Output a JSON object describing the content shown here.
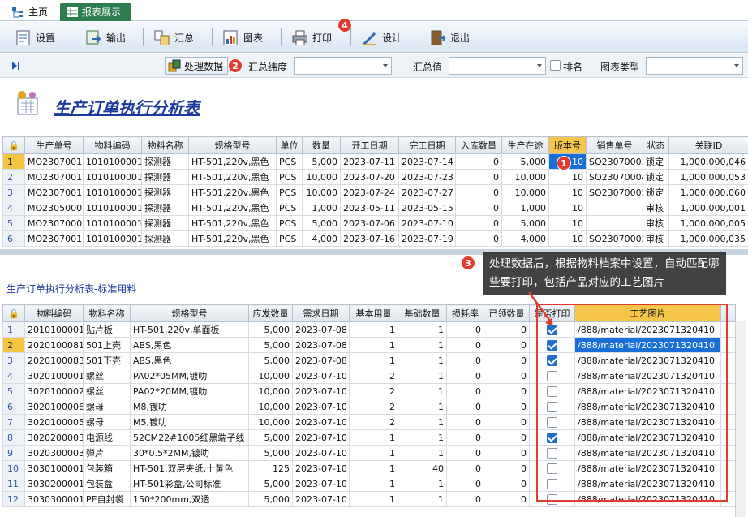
{
  "tabs": [
    {
      "label": "主页"
    },
    {
      "label": "报表展示"
    }
  ],
  "toolbar": {
    "settings": "设置",
    "export": "输出",
    "summary": "汇总",
    "chart": "图表",
    "print": "打印",
    "design": "设计",
    "exit": "退出",
    "badge4": "4"
  },
  "filter": {
    "process_label": "处理数据",
    "badge2": "2",
    "dim_label": "汇总纬度",
    "value_label": "汇总值",
    "rank_label": "排名",
    "charttype_label": "图表类型"
  },
  "report_title": "生产订单执行分析表",
  "grid1": {
    "headers": [
      "生产单号",
      "物料编码",
      "物料名称",
      "规格型号",
      "单位",
      "数量",
      "开工日期",
      "完工日期",
      "入库数量",
      "生产在途",
      "版本号",
      "销售单号",
      "状态",
      "关联ID"
    ],
    "rows": [
      [
        "1",
        "MO23070012",
        "1010100001",
        "探测器",
        "HT-501,220v,黑色",
        "PCS",
        "5,000",
        "2023-07-11",
        "2023-07-14",
        "0",
        "5,000",
        "10",
        "SO23070003",
        "锁定",
        "1,000,000,046"
      ],
      [
        "2",
        "MO23070015",
        "1010100001",
        "探测器",
        "HT-501,220v,黑色",
        "PCS",
        "10,000",
        "2023-07-20",
        "2023-07-23",
        "0",
        "10,000",
        "10",
        "SO23070004",
        "锁定",
        "1,000,000,053"
      ],
      [
        "3",
        "MO23070016",
        "1010100001",
        "探测器",
        "HT-501,220v,黑色",
        "PCS",
        "10,000",
        "2023-07-24",
        "2023-07-27",
        "0",
        "10,000",
        "10",
        "SO23070005",
        "锁定",
        "1,000,000,060"
      ],
      [
        "4",
        "MO23050001",
        "1010100001",
        "探测器",
        "HT-501,220v,黑色",
        "PCS",
        "1,000",
        "2023-05-11",
        "2023-05-15",
        "0",
        "1,000",
        "10",
        "",
        "审核",
        "1,000,000,001"
      ],
      [
        "5",
        "MO23070001",
        "1010100001",
        "探测器",
        "HT-501,220v,黑色",
        "PCS",
        "5,000",
        "2023-07-06",
        "2023-07-10",
        "0",
        "5,000",
        "10",
        "",
        "审核",
        "1,000,000,005"
      ],
      [
        "6",
        "MO23070011",
        "1010100001",
        "探测器",
        "HT-501,220v,黑色",
        "PCS",
        "4,000",
        "2023-07-16",
        "2023-07-19",
        "0",
        "4,000",
        "10",
        "SO23070002",
        "审核",
        "1,000,000,035"
      ]
    ],
    "badge1": "1"
  },
  "callout": {
    "badge3": "3",
    "text": "处理数据后，根据物料档案中设置，自动匹配哪些要打印，包括产品对应的工艺图片"
  },
  "sub_title": "生产订单执行分析表-标准用料",
  "grid2": {
    "headers": [
      "物料编码",
      "物料名称",
      "规格型号",
      "应发数量",
      "需求日期",
      "基本用量",
      "基础数量",
      "损耗率",
      "已领数量",
      "是否打印",
      "工艺图片"
    ],
    "rows": [
      {
        "n": "1",
        "cells": [
          "2010100001",
          "贴片板",
          "HT-501,220v,单面板",
          "5,000",
          "2023-07-08",
          "1",
          "1",
          "0",
          "0"
        ],
        "print": true,
        "img": "/888/material/2023071320410"
      },
      {
        "n": "2",
        "cells": [
          "2020100081",
          "501上壳",
          "ABS,黑色",
          "5,000",
          "2023-07-08",
          "1",
          "1",
          "0",
          "0"
        ],
        "print": true,
        "img": "/888/material/2023071320410"
      },
      {
        "n": "3",
        "cells": [
          "2020100083",
          "501下壳",
          "ABS,黑色",
          "5,000",
          "2023-07-08",
          "1",
          "1",
          "0",
          "0"
        ],
        "print": true,
        "img": "/888/material/2023071320410"
      },
      {
        "n": "4",
        "cells": [
          "3020100001",
          "螺丝",
          "PA02*05MM,镀叻",
          "10,000",
          "2023-07-10",
          "2",
          "1",
          "0",
          "0"
        ],
        "print": false,
        "img": "/888/material/2023071320410"
      },
      {
        "n": "5",
        "cells": [
          "3020100002",
          "螺丝",
          "PA02*20MM,镀叻",
          "10,000",
          "2023-07-10",
          "2",
          "1",
          "0",
          "0"
        ],
        "print": false,
        "img": "/888/material/2023071320410"
      },
      {
        "n": "6",
        "cells": [
          "3020100006",
          "螺母",
          "M8,镀叻",
          "10,000",
          "2023-07-10",
          "2",
          "1",
          "0",
          "0"
        ],
        "print": false,
        "img": "/888/material/2023071320410"
      },
      {
        "n": "7",
        "cells": [
          "3020100005",
          "螺母",
          "M5,镀叻",
          "10,000",
          "2023-07-10",
          "2",
          "1",
          "0",
          "0"
        ],
        "print": false,
        "img": "/888/material/2023071320410"
      },
      {
        "n": "8",
        "cells": [
          "3020200003",
          "电源线",
          "52CM22#1005红黑端子线",
          "5,000",
          "2023-07-10",
          "1",
          "1",
          "0",
          "0"
        ],
        "print": true,
        "img": "/888/material/2023071320410"
      },
      {
        "n": "9",
        "cells": [
          "3020300003",
          "弹片",
          "30*0.5*2MM,镀叻",
          "5,000",
          "2023-07-10",
          "1",
          "1",
          "0",
          "0"
        ],
        "print": false,
        "img": "/888/material/2023071320410"
      },
      {
        "n": "10",
        "cells": [
          "3030100001",
          "包装箱",
          "HT-501,双层夹纸,土黄色",
          "125",
          "2023-07-10",
          "1",
          "40",
          "0",
          "0"
        ],
        "print": false,
        "img": "/888/material/2023071320410"
      },
      {
        "n": "11",
        "cells": [
          "3030200001",
          "包装盒",
          "HT-501彩盒,公司标准",
          "5,000",
          "2023-07-10",
          "1",
          "1",
          "0",
          "0"
        ],
        "print": false,
        "img": "/888/material/2023071320410"
      },
      {
        "n": "12",
        "cells": [
          "3030300001",
          "PE自封袋",
          "150*200mm,双透",
          "5,000",
          "2023-07-10",
          "1",
          "1",
          "0",
          "0"
        ],
        "print": false,
        "img": "/888/material/2023071320410"
      }
    ]
  }
}
